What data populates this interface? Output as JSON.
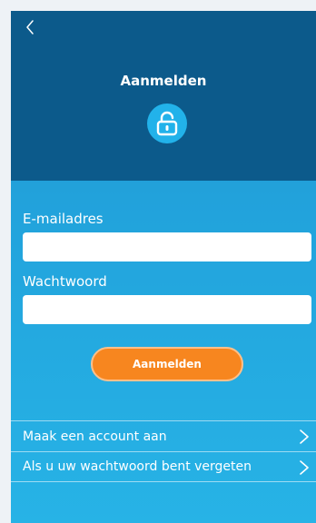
{
  "header": {
    "title": "Aanmelden"
  },
  "form": {
    "email_label": "E-mailadres",
    "email_value": "",
    "password_label": "Wachtwoord",
    "password_value": "",
    "submit_label": "Aanmelden"
  },
  "links": [
    {
      "label": "Maak een account aan"
    },
    {
      "label": "Als u uw wachtwoord bent vergeten"
    }
  ],
  "colors": {
    "header_bg": "#0c5a8b",
    "accent_button": "#f7861f",
    "lock_circle": "#22b2ea"
  },
  "icons": {
    "back": "chevron-left-icon",
    "lock": "unlock-icon",
    "chevron": "chevron-right-icon"
  }
}
